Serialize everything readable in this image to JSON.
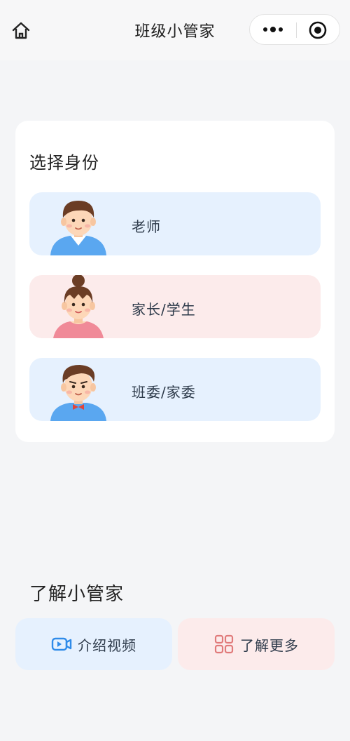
{
  "nav": {
    "title": "班级小管家",
    "icons": [
      "home-icon",
      "more-dots-icon",
      "target-icon"
    ]
  },
  "select_card": {
    "title": "选择身份",
    "roles": [
      {
        "label": "老师",
        "avatar": "teacher-avatar",
        "bg": "#e6f1fe"
      },
      {
        "label": "家长/学生",
        "avatar": "parent-student-avatar",
        "bg": "#fcebeb"
      },
      {
        "label": "班委/家委",
        "avatar": "committee-avatar",
        "bg": "#e6f1fe"
      }
    ]
  },
  "learn": {
    "title": "了解小管家",
    "buttons": [
      {
        "label": "介绍视频",
        "icon": "video-icon",
        "bg": "#e6f1fe",
        "icon_color": "#2f8be9"
      },
      {
        "label": "了解更多",
        "icon": "grid-icon",
        "bg": "#fcebeb",
        "icon_color": "#e07a7a"
      }
    ]
  },
  "colors": {
    "page_bg": "#f4f5f7",
    "blue_tint": "#e6f1fe",
    "pink_tint": "#fcebeb",
    "text_dark": "#2d3a4a"
  }
}
